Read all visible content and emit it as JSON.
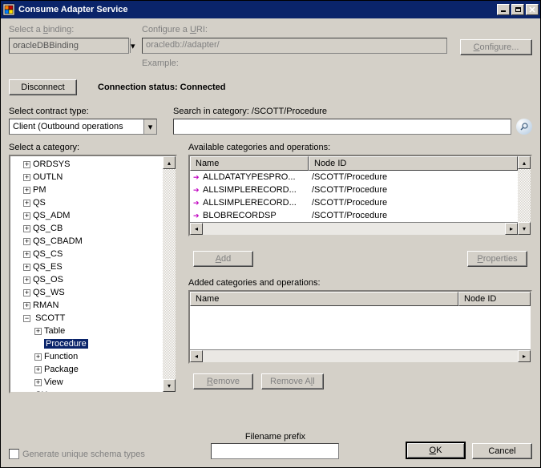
{
  "window": {
    "title": "Consume Adapter Service"
  },
  "labels": {
    "select_binding": "Select a binding:",
    "configure_uri": "Configure a URI:",
    "example": "Example:",
    "connection_status_label": "Connection status: ",
    "connection_status_value": "Connected",
    "select_contract": "Select contract type:",
    "search_in_category": "Search in category: /SCOTT/Procedure",
    "select_category": "Select a category:",
    "available": "Available categories and operations:",
    "added": "Added categories and operations:",
    "filename_prefix": "Filename prefix",
    "gen_schema": "Generate unique schema types",
    "col_name": "Name",
    "col_nodeid": "Node ID"
  },
  "fields": {
    "binding": "oracleDBBinding",
    "uri": "oracledb://adapter/",
    "contract": "Client (Outbound operations",
    "search": "",
    "filename_prefix": ""
  },
  "buttons": {
    "configure": "Configure...",
    "disconnect": "Disconnect",
    "add": "Add",
    "properties": "Properties",
    "remove": "Remove",
    "remove_all": "Remove All",
    "ok": "OK",
    "cancel": "Cancel"
  },
  "tree": {
    "nodes": [
      {
        "label": "ORDSYS",
        "exp": "+"
      },
      {
        "label": "OUTLN",
        "exp": "+"
      },
      {
        "label": "PM",
        "exp": "+"
      },
      {
        "label": "QS",
        "exp": "+"
      },
      {
        "label": "QS_ADM",
        "exp": "+"
      },
      {
        "label": "QS_CB",
        "exp": "+"
      },
      {
        "label": "QS_CBADM",
        "exp": "+"
      },
      {
        "label": "QS_CS",
        "exp": "+"
      },
      {
        "label": "QS_ES",
        "exp": "+"
      },
      {
        "label": "QS_OS",
        "exp": "+"
      },
      {
        "label": "QS_WS",
        "exp": "+"
      },
      {
        "label": "RMAN",
        "exp": "+"
      }
    ],
    "scott": {
      "label": "SCOTT",
      "exp": "−",
      "children": [
        {
          "label": "Table",
          "exp": "+"
        },
        {
          "label": "Procedure",
          "exp": "",
          "selected": true
        },
        {
          "label": "Function",
          "exp": "+"
        },
        {
          "label": "Package",
          "exp": "+"
        },
        {
          "label": "View",
          "exp": "+"
        }
      ]
    },
    "last": {
      "label": "SH",
      "exp": "+"
    }
  },
  "available_ops": [
    {
      "name": "ALLDATATYPESPRO...",
      "nodeid": "/SCOTT/Procedure"
    },
    {
      "name": "ALLSIMPLERECORD...",
      "nodeid": "/SCOTT/Procedure"
    },
    {
      "name": "ALLSIMPLERECORD...",
      "nodeid": "/SCOTT/Procedure"
    },
    {
      "name": "BLOBRECORDSP",
      "nodeid": "/SCOTT/Procedure"
    }
  ]
}
